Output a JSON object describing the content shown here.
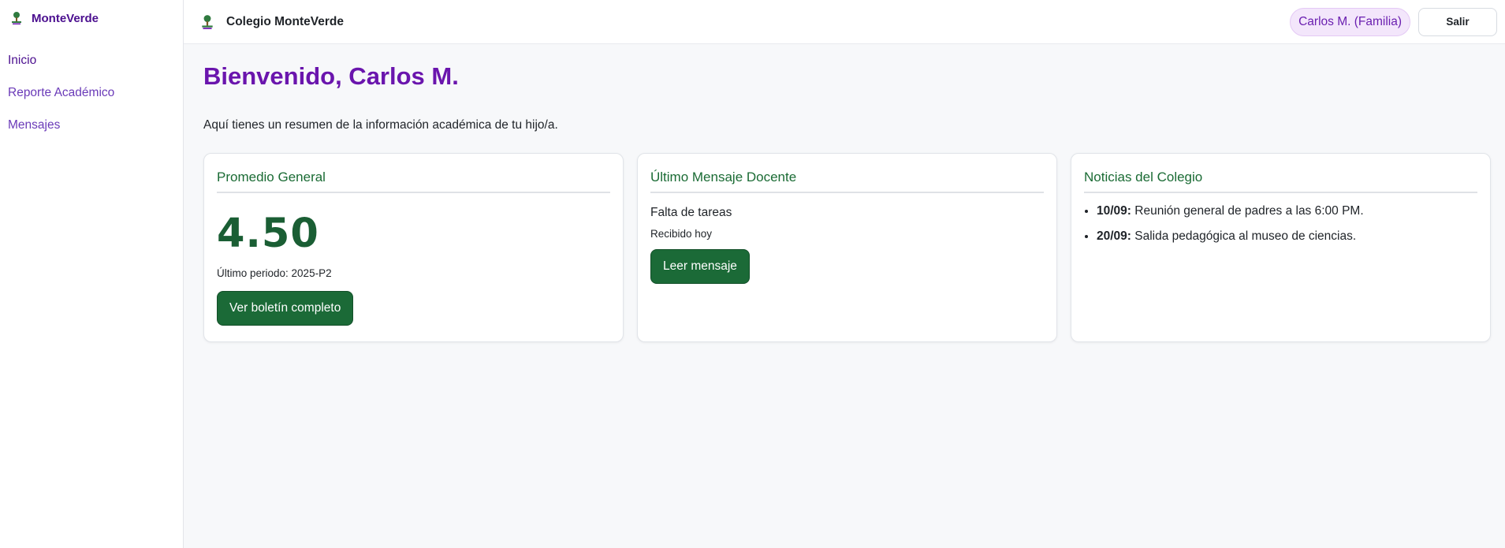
{
  "sidebar": {
    "brand": "MonteVerde",
    "items": [
      {
        "label": "Inicio"
      },
      {
        "label": "Reporte Académico"
      },
      {
        "label": "Mensajes"
      }
    ]
  },
  "topbar": {
    "title": "Colegio MonteVerde",
    "user": "Carlos M. (Familia)",
    "logout": "Salir"
  },
  "main": {
    "welcome": "Bienvenido, Carlos M.",
    "intro": "Aquí tienes un resumen de la información académica de tu hijo/a.",
    "average_card": {
      "title": "Promedio General",
      "value": "4.50",
      "period": "Último periodo: 2025-P2",
      "button": "Ver boletín completo"
    },
    "message_card": {
      "title": "Último Mensaje Docente",
      "subject": "Falta de tareas",
      "received": "Recibido hoy",
      "button": "Leer mensaje"
    },
    "news_card": {
      "title": "Noticias del Colegio",
      "items": [
        {
          "date": "10/09:",
          "text": "Reunión general de padres a las 6:00 PM."
        },
        {
          "date": "20/09:",
          "text": "Salida pedagógica al museo de ciencias."
        }
      ]
    }
  },
  "colors": {
    "brand_purple": "#6a15ad",
    "accent_green": "#1b6a37",
    "chip_bg": "#f3e6fb"
  },
  "icons": {
    "brand_logo": "school-crest-icon"
  }
}
